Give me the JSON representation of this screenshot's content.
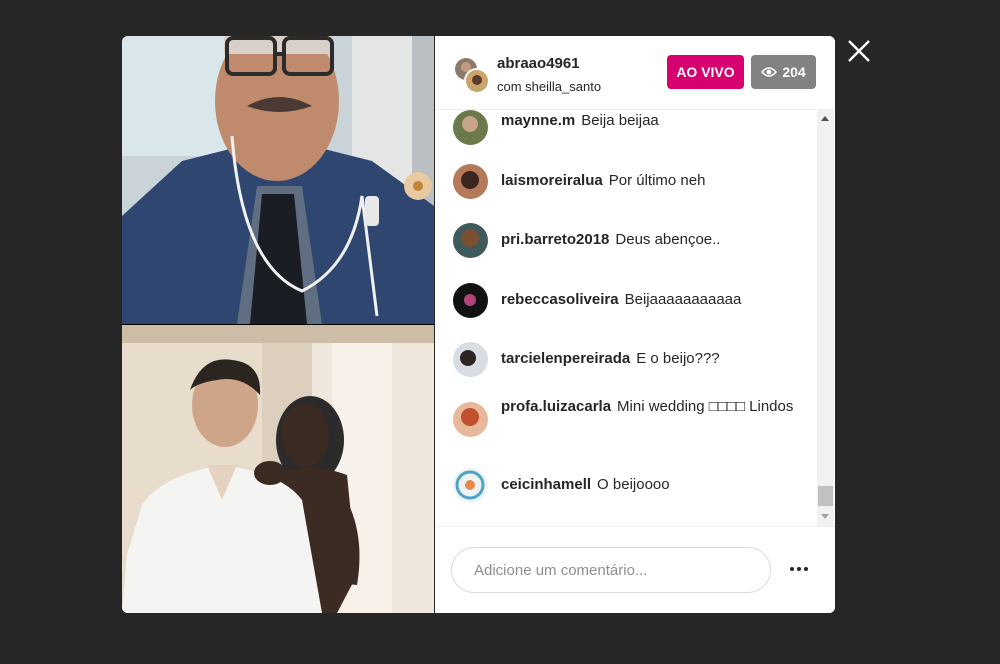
{
  "live": {
    "host_username": "abraao4961",
    "guest_line": "com sheilla_santo",
    "live_label": "AO VIVO",
    "viewer_count": "204"
  },
  "comments": [
    {
      "username": "maynne.m",
      "text": "Beija beijaa"
    },
    {
      "username": "laismoreiralua",
      "text": "Por último neh"
    },
    {
      "username": "pri.barreto2018",
      "text": "Deus abençoe.."
    },
    {
      "username": "rebeccasoliveira",
      "text": "Beijaaaaaaaaaaa"
    },
    {
      "username": "tarcielenpereirada",
      "text": "E o beijo???"
    },
    {
      "username": "profa.luizacarla",
      "text": "Mini wedding □□□□ Lindos"
    },
    {
      "username": "ceicinhamell",
      "text": "O beijoooo"
    }
  ],
  "footer": {
    "comment_placeholder": "Adicione um comentário..."
  },
  "colors": {
    "live_badge": "#d6006e",
    "viewer_badge": "#828282",
    "backdrop": "#262626"
  },
  "icons": [
    "close-icon",
    "eye-icon",
    "more-options-icon"
  ]
}
